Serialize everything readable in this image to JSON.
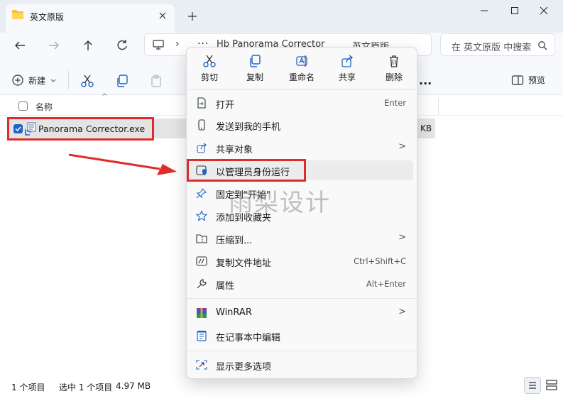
{
  "tab": {
    "title": "英文原版",
    "new_tab": "+"
  },
  "address": {
    "ellipsis": "···",
    "segments": [
      "Hb Panorama Corrector",
      "英文原版"
    ],
    "chevron": "›"
  },
  "search": {
    "placeholder": "在 英文原版 中搜索"
  },
  "commandbar": {
    "new_label": "新建",
    "more": "...",
    "preview_label": "预览"
  },
  "file_list": {
    "column_name": "名称",
    "sort_arrow": "^",
    "files": [
      {
        "name": "Panorama Corrector.exe",
        "size": "KB",
        "selected": true
      }
    ]
  },
  "context_menu": {
    "quick_actions": [
      {
        "label": "剪切",
        "icon": "scissors-icon"
      },
      {
        "label": "复制",
        "icon": "copy-icon"
      },
      {
        "label": "重命名",
        "icon": "rename-icon"
      },
      {
        "label": "共享",
        "icon": "share-icon"
      },
      {
        "label": "删除",
        "icon": "trash-icon"
      }
    ],
    "items": [
      {
        "label": "打开",
        "shortcut": "Enter",
        "icon": "open-file-icon"
      },
      {
        "label": "发送到我的手机",
        "shortcut": "",
        "icon": "phone-icon"
      },
      {
        "label": "共享对象",
        "shortcut": "",
        "submenu": ">",
        "icon": "share-icon"
      },
      {
        "label": "以管理员身份运行",
        "shortcut": "",
        "icon": "admin-shield-icon"
      },
      {
        "label": "固定到\"开始\"",
        "shortcut": "",
        "icon": "pin-icon"
      },
      {
        "label": "添加到收藏夹",
        "shortcut": "",
        "icon": "star-icon"
      },
      {
        "label": "压缩到...",
        "shortcut": "",
        "submenu": ">",
        "icon": "zip-icon"
      },
      {
        "label": "复制文件地址",
        "shortcut": "Ctrl+Shift+C",
        "icon": "copy-path-icon"
      },
      {
        "label": "属性",
        "shortcut": "Alt+Enter",
        "icon": "wrench-icon"
      },
      {
        "label": "WinRAR",
        "shortcut": "",
        "submenu": ">",
        "icon": "winrar-icon"
      },
      {
        "label": "在记事本中编辑",
        "shortcut": "",
        "icon": "notepad-icon"
      },
      {
        "label": "显示更多选项",
        "shortcut": "",
        "icon": "more-options-icon"
      }
    ]
  },
  "status": {
    "count": "1 个项目",
    "selected": "选中 1 个项目",
    "size": "4.97 MB"
  },
  "watermark": "雨梨设计",
  "colors": {
    "accent": "#1f64c4",
    "highlight_red": "#e02b2b",
    "title_bg": "#e9eef5"
  }
}
